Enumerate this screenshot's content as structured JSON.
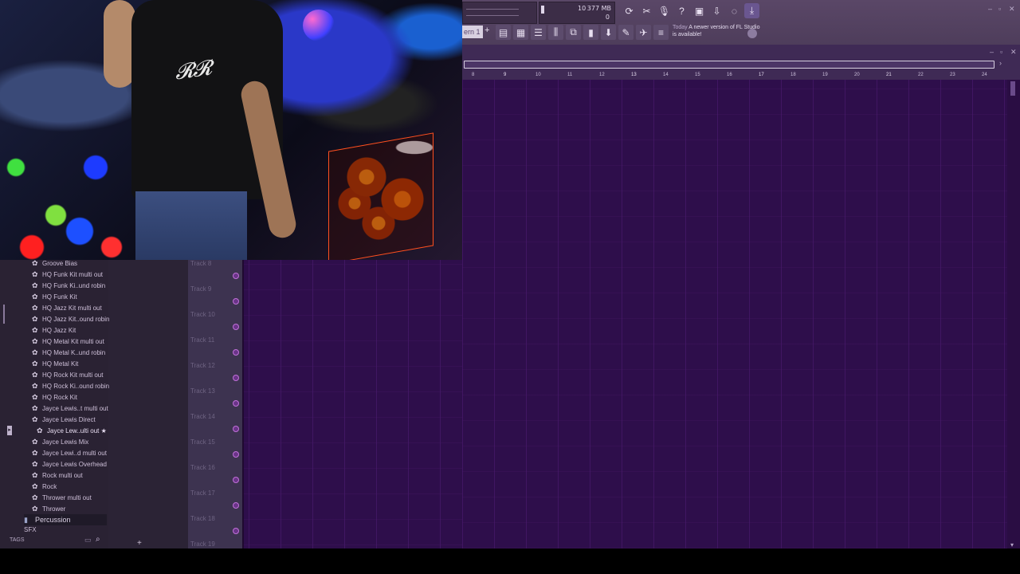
{
  "toolbar": {
    "memory": "377 MB",
    "cpu_value": "10",
    "polyphony": "0",
    "pattern_label": "ern 1",
    "news_when": "Today",
    "news_text": "A newer version of FL Studio is available!",
    "icons": [
      "refresh-icon",
      "cut-icon",
      "mic-icon",
      "help-icon",
      "save-icon",
      "render-icon",
      "chat-icon",
      "download-icon"
    ],
    "view_icons": [
      "playlist-icon",
      "piano-roll-icon",
      "channel-rack-icon",
      "mixer-icon",
      "plugin-picker-icon",
      "browser-icon",
      "touch-controller-icon",
      "tempo-tapper-icon",
      "link-icon",
      "hint-icon"
    ]
  },
  "ruler": {
    "numbers": [
      "8",
      "9",
      "10",
      "11",
      "12",
      "13",
      "14",
      "15",
      "16",
      "17",
      "18",
      "19",
      "20",
      "21",
      "22",
      "23",
      "24"
    ]
  },
  "tracks": [
    "Track 8",
    "Track 9",
    "Track 10",
    "Track 11",
    "Track 12",
    "Track 13",
    "Track 14",
    "Track 15",
    "Track 16",
    "Track 17",
    "Track 18",
    "Track 19"
  ],
  "browser": {
    "items": [
      "Groove Bias",
      "HQ Funk Kit multi out",
      "HQ Funk Ki..und robin",
      "HQ Funk Kit",
      "HQ Jazz Kit multi out",
      "HQ Jazz Kit..ound robin",
      "HQ Jazz Kit",
      "HQ Metal Kit multi out",
      "HQ Metal K..und robin",
      "HQ Metal Kit",
      "HQ Rock Kit multi out",
      "HQ Rock Ki..ound robin",
      "HQ Rock Kit",
      "Jayce Lewis..t multi out",
      "Jayce Lewis Direct",
      "Jayce Lew..ulti out ★",
      "Jayce Lewis Mix",
      "Jayce Lewi..d multi out",
      "Jayce Lewis Overhead",
      "Rock multi out",
      "Rock",
      "Thrower multi out",
      "Thrower"
    ],
    "folder_percussion": "Percussion",
    "folder_sfx": "SFX",
    "tags_label": "TAGS"
  },
  "colors": {
    "playlist_bg": "#2e0e4b",
    "toolbar_bg": "#5a4767",
    "accent": "#c070d8"
  }
}
